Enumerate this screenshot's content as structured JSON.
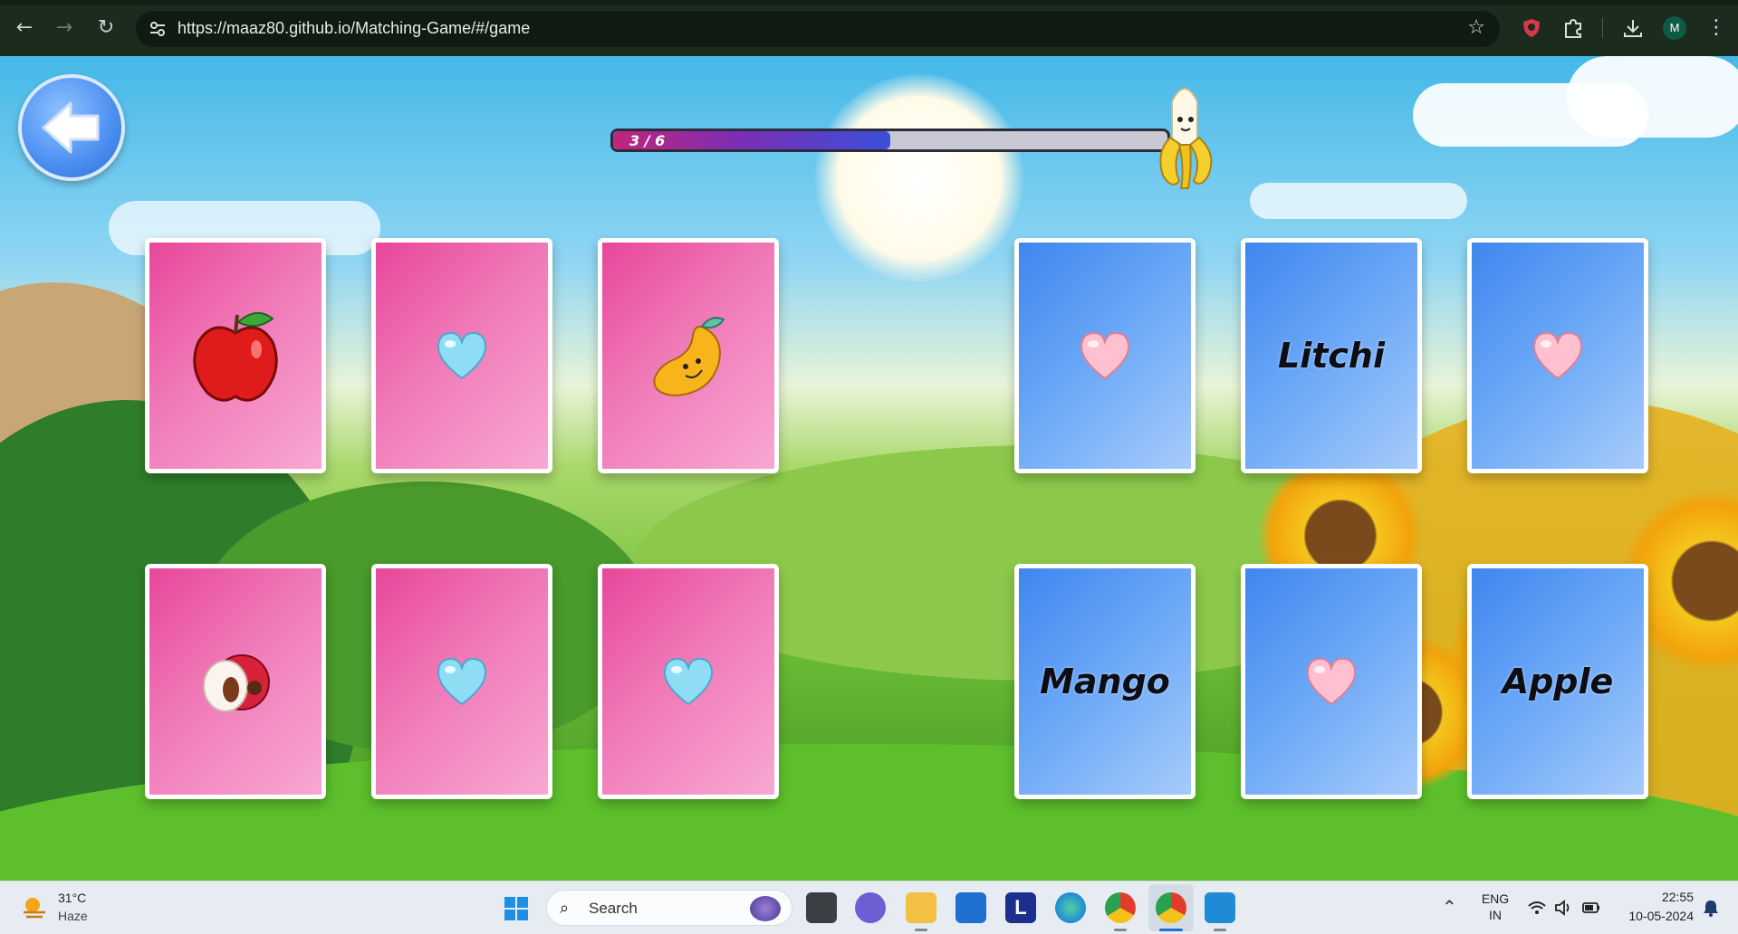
{
  "browser": {
    "url": "https://maaz80.github.io/Matching-Game/#/game",
    "profile_initial": "M"
  },
  "game": {
    "progress": {
      "label": "3 / 6",
      "matched": 3,
      "total": 6,
      "fraction": 0.5
    },
    "cards_left": [
      {
        "kind": "image",
        "icon": "apple-icon",
        "face": "pink"
      },
      {
        "kind": "hidden",
        "icon": "blue-heart-icon",
        "face": "pink"
      },
      {
        "kind": "image",
        "icon": "mango-icon",
        "face": "pink"
      },
      {
        "kind": "image",
        "icon": "litchi-icon",
        "face": "pink"
      },
      {
        "kind": "hidden",
        "icon": "blue-heart-icon",
        "face": "pink"
      },
      {
        "kind": "hidden",
        "icon": "blue-heart-icon",
        "face": "pink"
      }
    ],
    "cards_right": [
      {
        "kind": "hidden",
        "icon": "pink-heart-icon",
        "face": "blue"
      },
      {
        "kind": "word",
        "text": "Litchi",
        "face": "blue"
      },
      {
        "kind": "hidden",
        "icon": "pink-heart-icon",
        "face": "blue"
      },
      {
        "kind": "word",
        "text": "Mango",
        "face": "blue"
      },
      {
        "kind": "hidden",
        "icon": "pink-heart-icon",
        "face": "blue"
      },
      {
        "kind": "word",
        "text": "Apple",
        "face": "blue"
      }
    ],
    "colors": {
      "pink_card": "#e8479a",
      "blue_card": "#3f86ee",
      "progress_fill": "#7b2fb5"
    }
  },
  "taskbar": {
    "weather_temp": "31°C",
    "weather_condition": "Haze",
    "search_placeholder": "Search",
    "lang_line1": "ENG",
    "lang_line2": "IN",
    "time": "22:55",
    "date": "10-05-2024"
  }
}
